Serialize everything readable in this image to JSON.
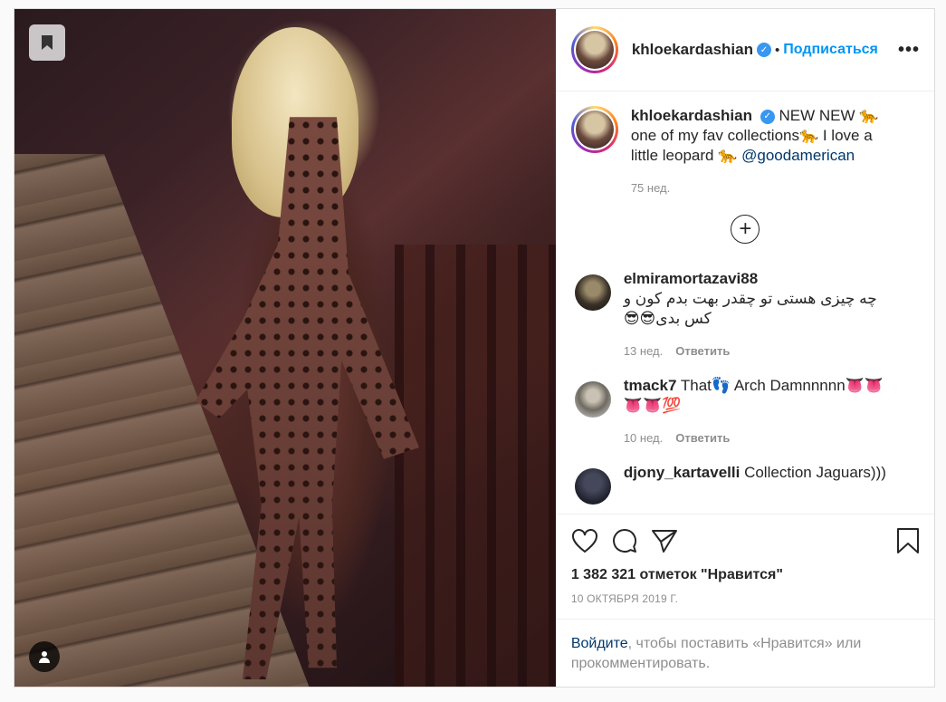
{
  "post": {
    "username": "khloekardashian",
    "follow_label": "Подписаться",
    "more_label": "•••",
    "dot": "•",
    "verified_mark": "✓",
    "caption_text": "NEW NEW 🐆 one of my fav collections🐆 I love a little leopard 🐆",
    "caption_mention": "@goodamerican",
    "caption_time": "75 нед.",
    "load_more_label": "+"
  },
  "comments": [
    {
      "username": "elmiramortazavi88",
      "text": "چه چیزی هستی تو چقدر بهت بدم کون و کس بدی😎😎",
      "time": "13 нед.",
      "reply_label": "Ответить"
    },
    {
      "username": "tmack7",
      "text": "That👣 Arch Damnnnnn👅👅👅👅💯",
      "time": "10 нед.",
      "reply_label": "Ответить"
    },
    {
      "username": "djony_kartavelli",
      "text": "Collection Jaguars)))",
      "time": "",
      "reply_label": ""
    }
  ],
  "actions": {
    "likes_text": "1 382 321 отметок \"Нравится\"",
    "date_text": "10 ОКТЯБРЯ 2019 Г.",
    "icons": [
      "heart-icon",
      "comment-icon",
      "share-icon",
      "bookmark-icon"
    ]
  },
  "login_prompt": {
    "link": "Войдите",
    "rest": ", чтобы поставить «Нравится» или прокомментировать."
  },
  "colors": {
    "accent": "#0095f6",
    "verified": "#3897f0",
    "muted": "#8e8e8e"
  }
}
